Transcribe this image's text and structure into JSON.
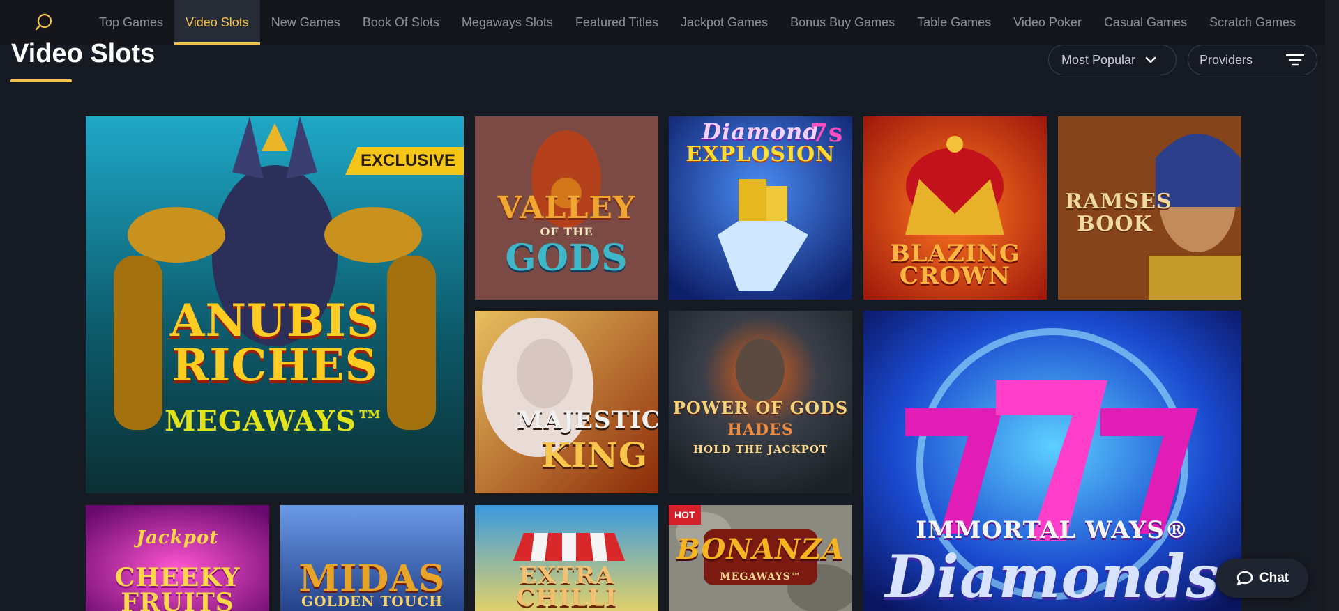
{
  "nav": {
    "search_icon": "search-icon",
    "items": [
      {
        "label": "Top Games"
      },
      {
        "label": "Video Slots",
        "active": true
      },
      {
        "label": "New Games"
      },
      {
        "label": "Book Of Slots"
      },
      {
        "label": "Megaways Slots"
      },
      {
        "label": "Featured Titles"
      },
      {
        "label": "Jackpot Games"
      },
      {
        "label": "Bonus Buy Games"
      },
      {
        "label": "Table Games"
      },
      {
        "label": "Video Poker"
      },
      {
        "label": "Casual Games"
      },
      {
        "label": "Scratch Games"
      }
    ]
  },
  "header": {
    "title": "Video Slots",
    "sort_label": "Most Popular",
    "providers_label": "Providers"
  },
  "games": {
    "anubis": {
      "line1": "ANUBIS",
      "line2": "RICHES",
      "line3": "MEGAWAYS™",
      "badge": "EXCLUSIVE"
    },
    "valley": {
      "line1": "VALLEY",
      "line2": "OF THE",
      "line3": "GODS"
    },
    "diamond": {
      "line1": "Diamond",
      "line2": "EXPLOSION",
      "line3": "7s"
    },
    "blazing": {
      "line1": "BLAZING",
      "line2": "CROWN"
    },
    "ramses": {
      "line1": "RAMSES",
      "line2": "BOOK"
    },
    "majestic": {
      "line1": "MAJESTIC",
      "line2": "KING"
    },
    "power": {
      "line1": "POWER OF GODS",
      "line2": "HADES",
      "line3": "HOLD THE JACKPOT"
    },
    "immortal": {
      "line1": "IMMORTAL WAYS®",
      "line2": "Diamonds"
    },
    "cheeky": {
      "line1": "Jackpot",
      "line2": "CHEEKY",
      "line3": "FRUITS"
    },
    "midas": {
      "line1": "MIDAS",
      "line2": "GOLDEN TOUCH"
    },
    "extra": {
      "line1": "EXTRA",
      "line2": "CHILLI"
    },
    "bonanza": {
      "line1": "BONANZA",
      "line2": "MEGAWAYS™",
      "badge": "HOT"
    }
  },
  "chat": {
    "label": "Chat"
  },
  "colors": {
    "accent": "#f2c14e",
    "background": "#161a22",
    "nav_bg": "#14161b"
  }
}
